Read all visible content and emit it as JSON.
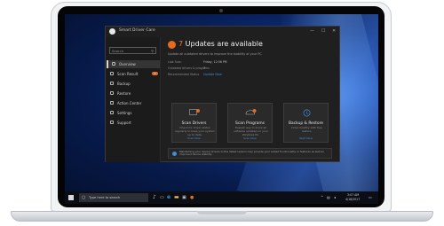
{
  "app": {
    "title": "Smart Driver Care",
    "window_controls": [
      "—",
      "☐",
      "✕"
    ]
  },
  "sidebar": {
    "search_placeholder": "Search",
    "items": [
      {
        "label": "Overview",
        "active": true
      },
      {
        "label": "Scan Result",
        "badge": "7"
      },
      {
        "label": "Backup"
      },
      {
        "label": "Restore"
      },
      {
        "label": "Action Center"
      },
      {
        "label": "Settings"
      },
      {
        "label": "Support"
      }
    ]
  },
  "header": {
    "count": "7",
    "title_rest": "Updates are available",
    "subtitle": "Update all outdated drivers to improve the stability of your PC",
    "meta": [
      {
        "label": "Last Scan",
        "value": "Friday, 12:56 PM"
      },
      {
        "label": "Outdated drivers & programs",
        "value": "7"
      },
      {
        "label": "Recommended Status",
        "value": "Update Now"
      }
    ]
  },
  "cards": [
    {
      "title": "Scan Drivers",
      "desc": "Check for driver status regularly to keep your system up to date.",
      "link": "Scan Now",
      "icon": "driver-icon"
    },
    {
      "title": "Scan Programs",
      "desc": "Easiest way to know all software updated on your Windows PC.",
      "link": "Scan Now",
      "icon": "programs-icon"
    },
    {
      "title": "Backup & Restore",
      "desc": "Drive healthy with free restore.",
      "link": "Start Now",
      "icon": "backup-icon"
    }
  ],
  "notice": "Maintaining your device drivers to the latest version may provide your added functionality or features as well as improved device stability.",
  "taskbar": {
    "search_text": "Type here to search",
    "time": "3:07 AM",
    "date": "4/18/2017"
  },
  "colors": {
    "accent": "#e56b1f",
    "link": "#3d8fd9",
    "window_bg": "#1f1f1f"
  }
}
